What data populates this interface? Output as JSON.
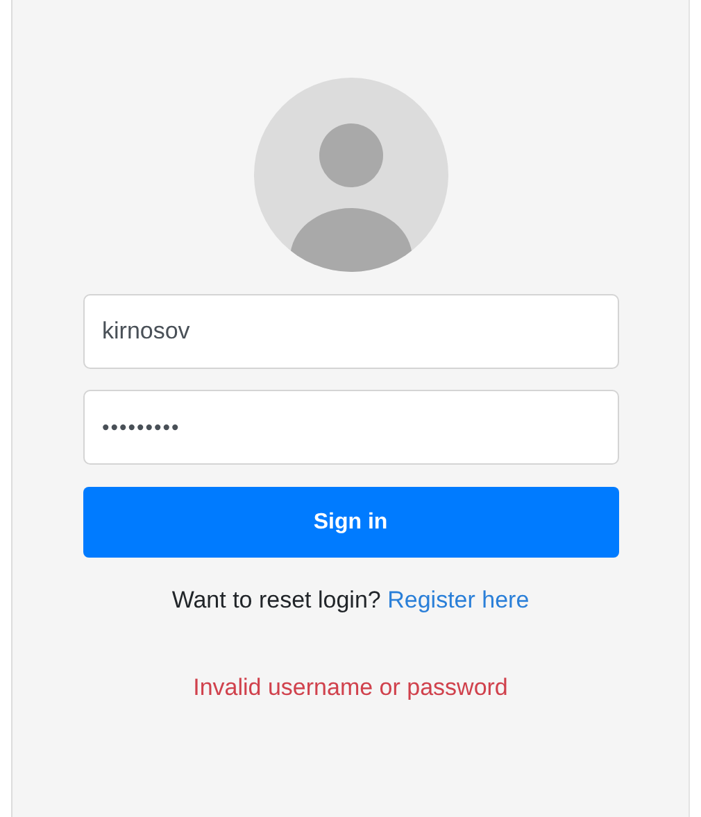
{
  "login": {
    "avatar": {
      "kind": "avatar"
    },
    "username": {
      "value": "kirnosov"
    },
    "password": {
      "value": "•••••••••"
    },
    "submit": {
      "label": "Sign in"
    },
    "reset_prompt": {
      "text": "Want to reset login?",
      "link": "Register here"
    },
    "error": {
      "text": "Invalid username or password"
    }
  }
}
